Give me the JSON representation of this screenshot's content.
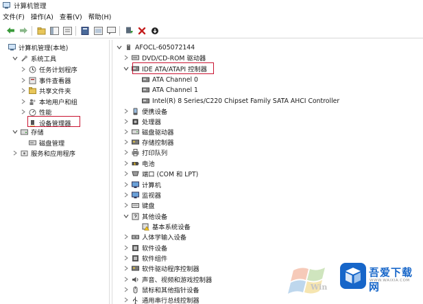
{
  "window": {
    "title": "计算机管理"
  },
  "menu": [
    {
      "label": "文件(F)"
    },
    {
      "label": "操作(A)"
    },
    {
      "label": "查看(V)"
    },
    {
      "label": "帮助(H)"
    }
  ],
  "toolbar": [
    "back-icon",
    "forward-icon",
    "up-folder-icon",
    "show-tree-icon",
    "properties-icon",
    "help-icon",
    "console-icon",
    "comment-icon",
    "update-driver-icon",
    "delete-icon",
    "download-icon"
  ],
  "left_tree": {
    "root": "计算机管理(本地)",
    "system_tools": "系统工具",
    "task_scheduler": "任务计划程序",
    "event_viewer": "事件查看器",
    "shared_folders": "共享文件夹",
    "local_users": "本地用户和组",
    "performance": "性能",
    "device_manager": "设备管理器",
    "storage": "存储",
    "disk_management": "磁盘管理",
    "services": "服务和应用程序"
  },
  "device_tree": {
    "computer": "AFOCL-605072144",
    "dvd": "DVD/CD-ROM 驱动器",
    "ide": "IDE ATA/ATAPI 控制器",
    "ide_children": [
      "ATA Channel 0",
      "ATA Channel 1",
      "Intel(R) 8 Series/C220 Chipset Family SATA AHCI Controller"
    ],
    "portable": "便携设备",
    "processor": "处理器",
    "disk_drives": "磁盘驱动器",
    "storage_ctrl": "存储控制器",
    "print_queue": "打印队列",
    "battery": "电池",
    "ports": "端口 (COM 和 LPT)",
    "computer_node": "计算机",
    "monitors": "监视器",
    "keyboard": "键盘",
    "other": "其他设备",
    "other_child": "基本系统设备",
    "hid": "人体学输入设备",
    "software_dev": "软件设备",
    "software_comp": "软件组件",
    "sw_driver_ctrl": "软件驱动程序控制器",
    "sound": "声音、视频和游戏控制器",
    "mice": "鼠标和其他指针设备",
    "usb": "通用串行总线控制器"
  },
  "watermark": {
    "brand": "吾爱下载网",
    "url": "WWW.WAIXIA.COM"
  },
  "colors": {
    "highlight": "#c8102e",
    "brand": "#1766c9"
  }
}
